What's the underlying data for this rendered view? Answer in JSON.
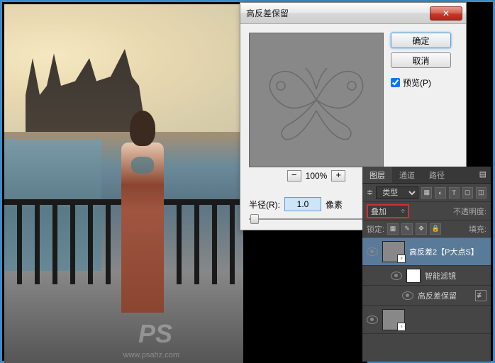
{
  "dialog": {
    "title": "高反差保留",
    "ok": "确定",
    "cancel": "取消",
    "preview_label": "预览(P)",
    "zoom": "100%",
    "radius_label": "半径(R):",
    "radius_value": "1.0",
    "radius_unit": "像素"
  },
  "panel": {
    "tab_layers": "图层",
    "tab_channels": "通道",
    "tab_paths": "路径",
    "kind_label": "类型",
    "blend_mode": "叠加",
    "opacity_label": "不透明度:",
    "lock_label": "锁定:",
    "fill_label": "填充:",
    "layer1": "高反差2【P大点S】",
    "layer_smart": "智能滤镜",
    "layer_filter": "高反差保留"
  },
  "watermark": {
    "text": "PS",
    "url": "www.psahz.com"
  },
  "icons": {
    "close": "✕",
    "minus": "−",
    "plus": "+",
    "dropdown": "≑",
    "menu": "▤"
  }
}
